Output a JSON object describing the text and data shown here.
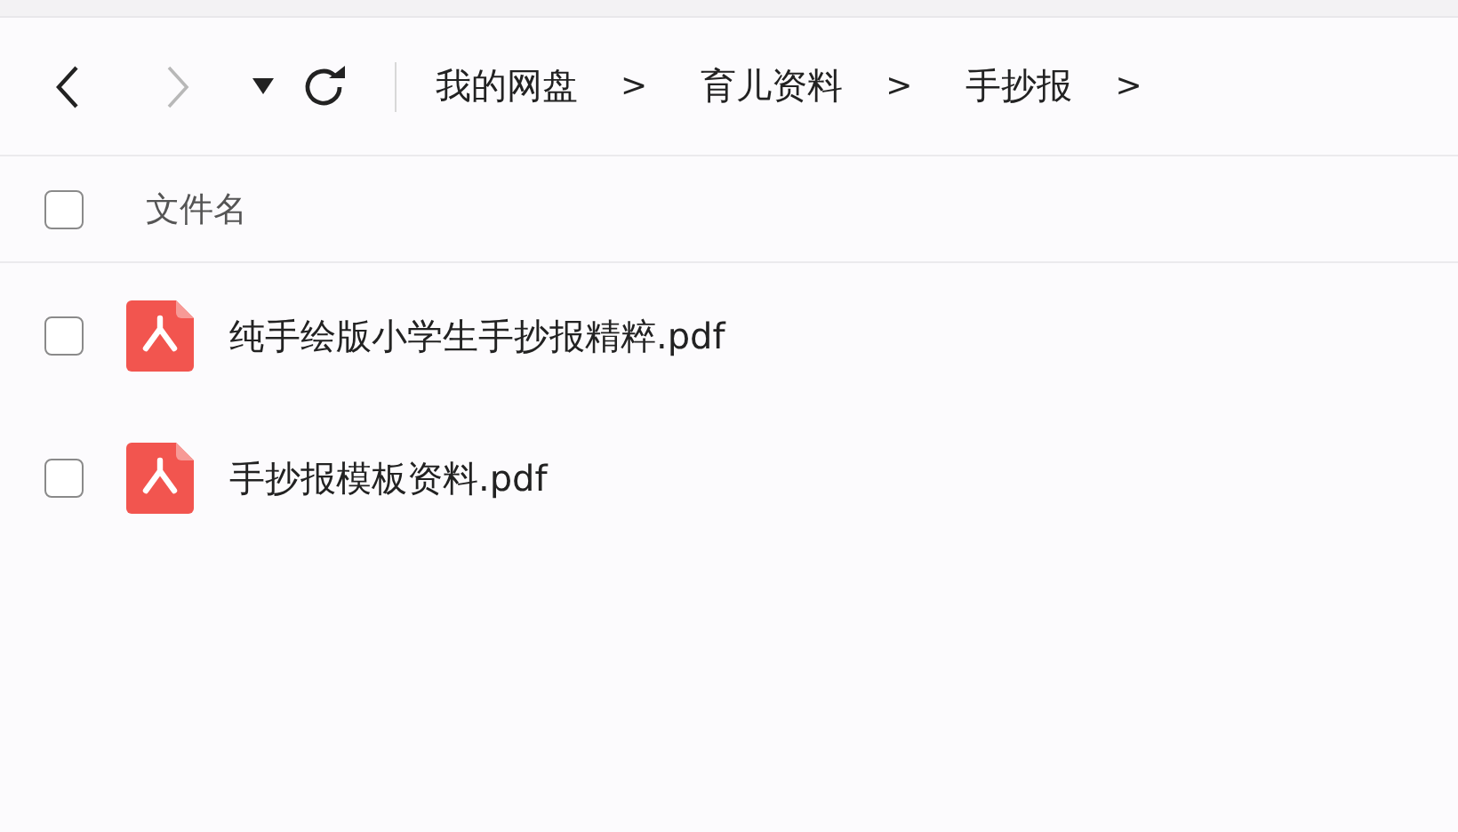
{
  "toolbar": {
    "back": {
      "disabled": false
    },
    "forward": {
      "disabled": true
    },
    "breadcrumb": [
      {
        "label": "我的网盘",
        "separator": ">"
      },
      {
        "label": "育儿资料",
        "separator": ">"
      },
      {
        "label": "手抄报",
        "separator": ">"
      }
    ]
  },
  "list": {
    "header": {
      "label": "文件名",
      "checked": false
    },
    "files": [
      {
        "name": "纯手绘版小学生手抄报精粹.pdf",
        "kind": "pdf",
        "checked": false
      },
      {
        "name": "手抄报模板资料.pdf",
        "kind": "pdf",
        "checked": false
      }
    ]
  }
}
